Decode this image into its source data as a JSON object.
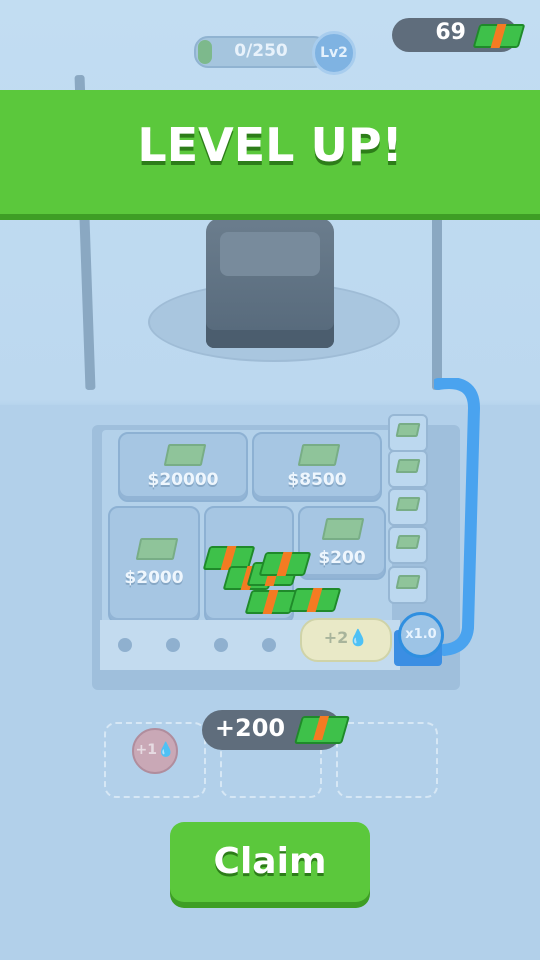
{
  "hud": {
    "progress_text": "0/250",
    "progress_fraction": 0.0,
    "level_label": "Lv2",
    "money_amount": "69",
    "money_icon": "cash-stack-icon"
  },
  "banner": {
    "title": "LEVEL UP!"
  },
  "board": {
    "slots": [
      {
        "label": "$20000"
      },
      {
        "label": "$8500"
      },
      {
        "label": "$2000"
      },
      {
        "label": ""
      },
      {
        "label": "$200"
      }
    ],
    "pump_label": "+2💧",
    "multiplier_label": "x1.0",
    "bubble_label": "+1💧"
  },
  "reward": {
    "amount": "+200",
    "icon": "cash-stack-icon"
  },
  "claim": {
    "label": "Claim"
  },
  "colors": {
    "banner_green": "#5bc83c",
    "cash_green": "#3ec14a",
    "cash_band": "#f47b22",
    "pill_dark": "#5f6d7c",
    "pipe_blue": "#3b8ee3"
  }
}
